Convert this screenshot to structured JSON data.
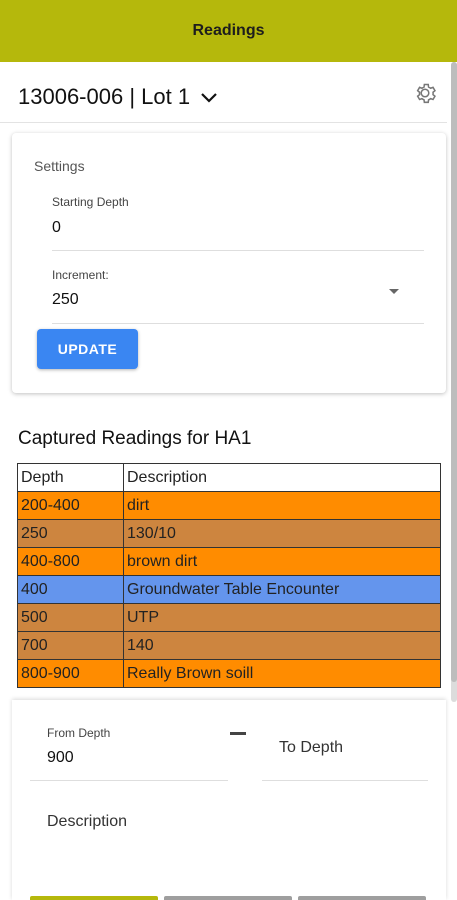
{
  "appbar": {
    "title": "Readings",
    "color": "#b5b80c"
  },
  "header": {
    "project": "13006-006 | Lot 1",
    "dropdown_icon": "chevron-down-icon",
    "settings_icon": "gear-icon"
  },
  "settings": {
    "title": "Settings",
    "starting_depth": {
      "label": "Starting Depth",
      "value": "0"
    },
    "increment": {
      "label": "Increment:",
      "value": "250"
    },
    "update_label": "UPDATE"
  },
  "readings": {
    "title": "Captured Readings for HA1",
    "columns": [
      "Depth",
      "Description"
    ],
    "rows": [
      {
        "depth": "200-400",
        "description": "dirt",
        "color": "#ff8c00"
      },
      {
        "depth": "250",
        "description": "130/10",
        "color": "#cd853f"
      },
      {
        "depth": "400-800",
        "description": "brown dirt",
        "color": "#ff8c00"
      },
      {
        "depth": "400",
        "description": "Groundwater Table Encounter",
        "color": "#6495ed"
      },
      {
        "depth": "500",
        "description": "UTP",
        "color": "#cd853f"
      },
      {
        "depth": "700",
        "description": "140",
        "color": "#cd853f"
      },
      {
        "depth": "800-900",
        "description": "Really Brown soill",
        "color": "#ff8c00"
      }
    ]
  },
  "form": {
    "from_depth": {
      "label": "From Depth",
      "value": "900"
    },
    "to_depth": {
      "placeholder": "To Depth"
    },
    "description": {
      "placeholder": "Description"
    }
  }
}
